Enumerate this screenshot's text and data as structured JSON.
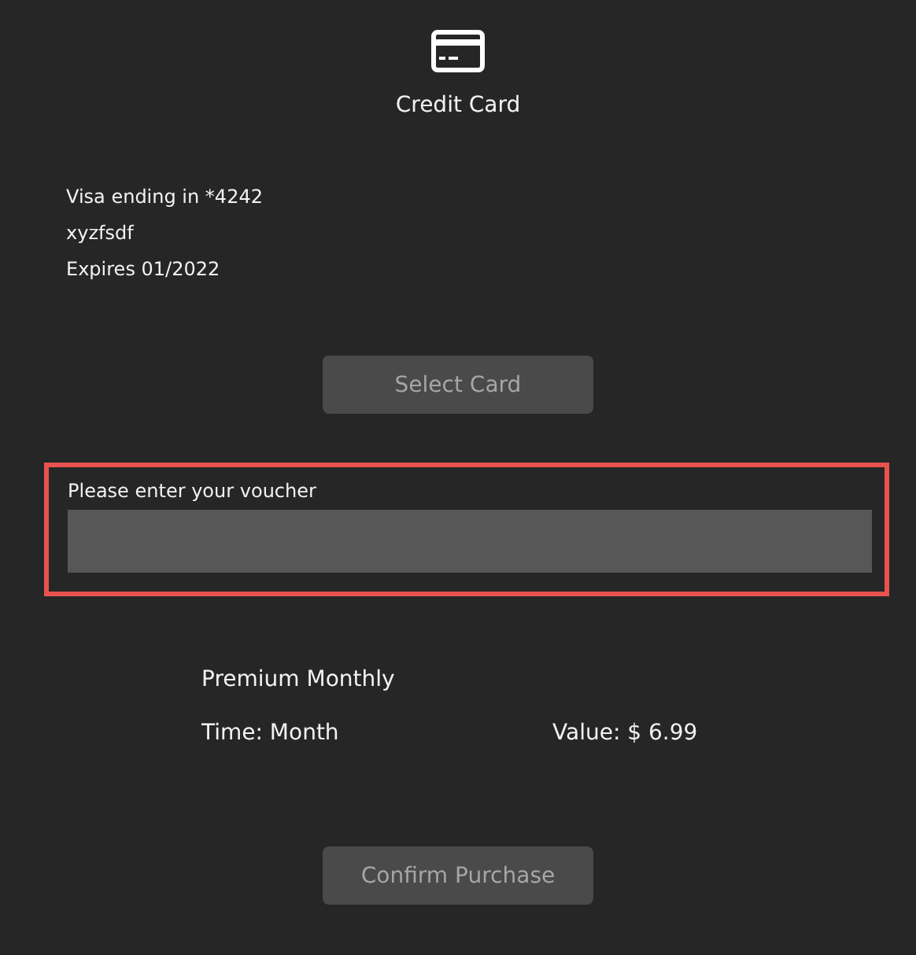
{
  "header": {
    "title": "Credit Card"
  },
  "card": {
    "lines": [
      "Visa ending in *4242",
      "xyzfsdf",
      "Expires 01/2022"
    ]
  },
  "select_button": {
    "label": "Select Card",
    "disabled": true
  },
  "voucher": {
    "label": "Please enter your voucher",
    "highlighted": true
  },
  "plan": {
    "name": "Premium Monthly",
    "time": "Time: Month",
    "value": "Value: $ 6.99"
  },
  "confirm_button": {
    "label": "Confirm Purchase",
    "disabled": true
  }
}
